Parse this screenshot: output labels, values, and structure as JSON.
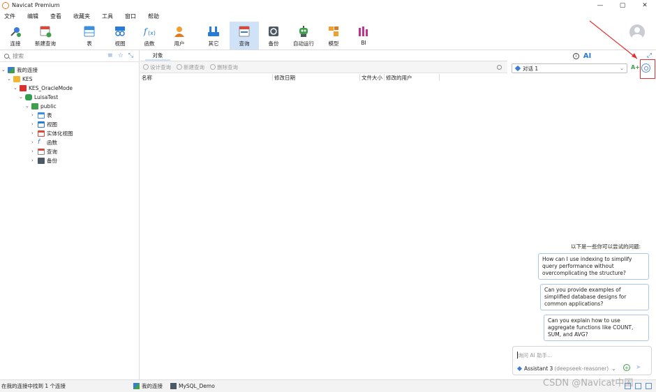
{
  "app": {
    "title": "Navicat Premium"
  },
  "window_controls": {
    "minimize": "—",
    "maximize": "▢",
    "close": "✕"
  },
  "menu": [
    "文件",
    "编辑",
    "查看",
    "收藏夹",
    "工具",
    "窗口",
    "帮助"
  ],
  "toolbar": [
    {
      "label": "连接",
      "icon": "connect-icon",
      "color": "#3a7bd5"
    },
    {
      "label": "新建查询",
      "icon": "new-query-icon",
      "color": "#d9483b"
    },
    {
      "label": "表",
      "icon": "table-icon",
      "color": "#3a8fe0"
    },
    {
      "label": "视图",
      "icon": "view-icon",
      "color": "#2a7bd4"
    },
    {
      "label": "函数",
      "icon": "function-icon",
      "color": "#2a7bd4"
    },
    {
      "label": "用户",
      "icon": "user-icon",
      "color": "#f0a030"
    },
    {
      "label": "其它",
      "icon": "other-icon",
      "color": "#2a7bd4"
    },
    {
      "label": "查询",
      "icon": "query-icon",
      "color": "#d9483b",
      "active": true
    },
    {
      "label": "备份",
      "icon": "backup-icon",
      "color": "#4d5a66"
    },
    {
      "label": "自动运行",
      "icon": "automation-icon",
      "color": "#3ea04a"
    },
    {
      "label": "模型",
      "icon": "model-icon",
      "color": "#f0a030"
    },
    {
      "label": "BI",
      "icon": "bi-icon",
      "color": "#c2338c"
    }
  ],
  "left": {
    "search_placeholder": "搜索",
    "tree": [
      {
        "label": "我的连接",
        "icon": "connections-icon",
        "level": 0,
        "color": "#3a7bd5"
      },
      {
        "label": "KES",
        "icon": "folder-icon",
        "level": 1,
        "color": "#f2b632"
      },
      {
        "label": "KES_OracleMode",
        "icon": "kes-icon",
        "level": 2,
        "color": "#d9312c"
      },
      {
        "label": "LuisaTest",
        "icon": "database-icon",
        "level": 3,
        "color": "#2e9e4f"
      },
      {
        "label": "public",
        "icon": "schema-icon",
        "level": 4,
        "color": "#3ea04a"
      },
      {
        "label": "表",
        "icon": "table-icon",
        "level": 5,
        "color": "#3a8fe0"
      },
      {
        "label": "视图",
        "icon": "view-icon",
        "level": 5,
        "color": "#2a7bd4"
      },
      {
        "label": "实体化视图",
        "icon": "materialized-view-icon",
        "level": 5,
        "color": "#d9483b"
      },
      {
        "label": "函数",
        "icon": "function-icon",
        "level": 5,
        "color": "#2a7bd4"
      },
      {
        "label": "查询",
        "icon": "query-icon",
        "level": 5,
        "color": "#d9483b"
      },
      {
        "label": "备份",
        "icon": "backup-icon",
        "level": 5,
        "color": "#4d5a66"
      }
    ]
  },
  "middle": {
    "tab": "对象",
    "actions": [
      "设计查询",
      "新建查询",
      "删除查询"
    ],
    "columns": [
      "名称",
      "修改日期",
      "文件大小",
      "修改的用户"
    ]
  },
  "right": {
    "ai_label": "AI",
    "conversation": "对话 1",
    "suggest_title": "以下是一些你可以尝试的问题:",
    "suggestions": [
      "How can I use indexing to simplify query performance without overcomplicating the structure?",
      "Can you provide examples of simplified database designs for common applications?",
      "Can you explain how to use aggregate functions like COUNT, SUM, and AVG?"
    ],
    "input_placeholder": "询问 AI 助手...",
    "assistant": "Assistant 3",
    "model": "(deepseek-reasoner)"
  },
  "status": {
    "found": "在我的连接中找到 1 个连接",
    "connection": "我的连接",
    "demo": "MySQL_Demo"
  },
  "watermark": "CSDN @Navicat中国",
  "colors": {
    "accent": "#2a7bd4",
    "highlight": "#e0332f",
    "active_bg": "#cfe2f7"
  }
}
